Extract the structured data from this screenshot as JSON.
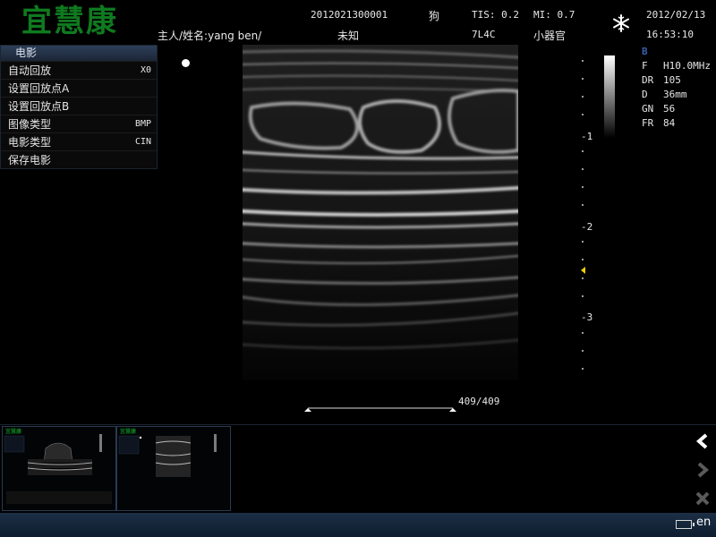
{
  "header": {
    "logo": "宜慧康",
    "patient_id": "2012021300001",
    "species": "狗",
    "tis": "TIS: 0.2",
    "mi": "MI: 0.7",
    "date": "2012/02/13",
    "owner": "主人/姓名:yang ben/",
    "sex": "未知",
    "probe": "7L4C",
    "preset": "小器官",
    "time": "16:53:10",
    "freeze_icon": "snowflake-icon"
  },
  "cine_menu": {
    "title": "电影",
    "items": [
      {
        "label": "自动回放",
        "value": "X0"
      },
      {
        "label": "设置回放点A",
        "value": ""
      },
      {
        "label": "设置回放点B",
        "value": ""
      },
      {
        "label": "图像类型",
        "value": "BMP"
      },
      {
        "label": "电影类型",
        "value": "CIN"
      },
      {
        "label": "保存电影",
        "value": ""
      }
    ]
  },
  "depth_scale": {
    "labels": [
      "-1",
      "-2",
      "-3"
    ],
    "focus_marker_color": "#f0d000"
  },
  "params": {
    "mode": "B",
    "rows": [
      {
        "key": "F",
        "value": "H10.0MHz"
      },
      {
        "key": "DR",
        "value": "105"
      },
      {
        "key": "D",
        "value": "36mm"
      },
      {
        "key": "GN",
        "value": "56"
      },
      {
        "key": "FR",
        "value": "84"
      }
    ]
  },
  "cine": {
    "frame_text": "409/409",
    "position": 1.0
  },
  "thumbnails": [
    {
      "name": "thumbnail-1"
    },
    {
      "name": "thumbnail-2"
    }
  ],
  "nav_icons": [
    "chevron-left-icon",
    "chevron-right-icon",
    "close-icon"
  ],
  "status": {
    "language": "en",
    "battery_icon": "battery-icon"
  },
  "colors": {
    "logo": "#0f7a1f",
    "menu_header": "#2d3f57",
    "bottom_bar": "#1c2f45"
  }
}
